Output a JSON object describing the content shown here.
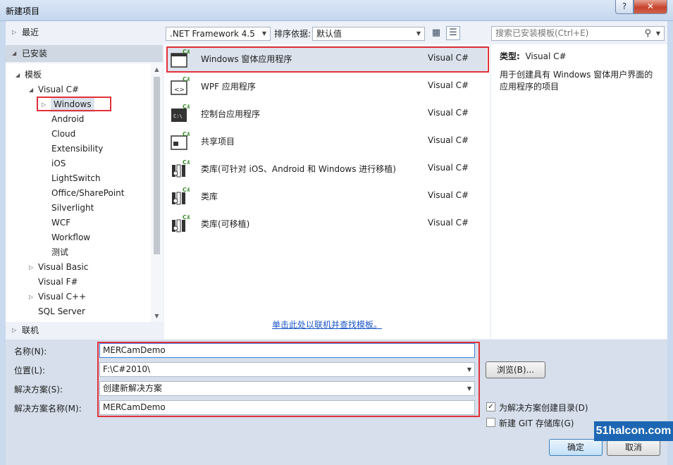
{
  "window": {
    "title": "新建项目",
    "help_label": "?",
    "close_label": "✕"
  },
  "tree": {
    "recent": "最近",
    "installed": "已安装",
    "online": "联机",
    "nodes": [
      {
        "label": "模板"
      },
      {
        "label": "Visual C#"
      },
      {
        "label": "Windows"
      },
      {
        "label": "Android"
      },
      {
        "label": "Cloud"
      },
      {
        "label": "Extensibility"
      },
      {
        "label": "iOS"
      },
      {
        "label": "LightSwitch"
      },
      {
        "label": "Office/SharePoint"
      },
      {
        "label": "Silverlight"
      },
      {
        "label": "WCF"
      },
      {
        "label": "Workflow"
      },
      {
        "label": "测试"
      },
      {
        "label": "Visual Basic"
      },
      {
        "label": "Visual F#"
      },
      {
        "label": "Visual C++"
      },
      {
        "label": "SQL Server"
      }
    ]
  },
  "toolbar": {
    "framework": ".NET Framework 4.5",
    "sort_label": "排序依据:",
    "sort_value": "默认值"
  },
  "templates": [
    {
      "name": "Windows 窗体应用程序",
      "lang": "Visual C#"
    },
    {
      "name": "WPF 应用程序",
      "lang": "Visual C#"
    },
    {
      "name": "控制台应用程序",
      "lang": "Visual C#"
    },
    {
      "name": "共享项目",
      "lang": "Visual C#"
    },
    {
      "name": "类库(可针对 iOS、Android 和 Windows 进行移植)",
      "lang": "Visual C#"
    },
    {
      "name": "类库",
      "lang": "Visual C#"
    },
    {
      "name": "类库(可移植)",
      "lang": "Visual C#"
    }
  ],
  "online_link": "单击此处以联机并查找模板。",
  "search": {
    "placeholder": "搜索已安装模板(Ctrl+E)"
  },
  "details": {
    "type_label": "类型:",
    "type_value": "Visual C#",
    "description": "用于创建具有 Windows 窗体用户界面的应用程序的项目"
  },
  "form": {
    "name_label": "名称(N):",
    "name_value": "MERCamDemo",
    "location_label": "位置(L):",
    "location_value": "F:\\C#2010\\",
    "solution_label": "解决方案(S):",
    "solution_value": "创建新解决方案",
    "solution_name_label": "解决方案名称(M):",
    "solution_name_value": "MERCamDemo",
    "browse_label": "浏览(B)...",
    "create_dir_label": "为解决方案创建目录(D)",
    "create_dir_checked": true,
    "git_label": "新建 GIT 存储库(G)",
    "git_checked": false,
    "ok_label": "确定",
    "cancel_label": "取消"
  },
  "watermark": "51halcon.com",
  "colors": {
    "highlight": "#e2313a",
    "link": "#1a55c6",
    "selection": "#dbe2ec"
  }
}
